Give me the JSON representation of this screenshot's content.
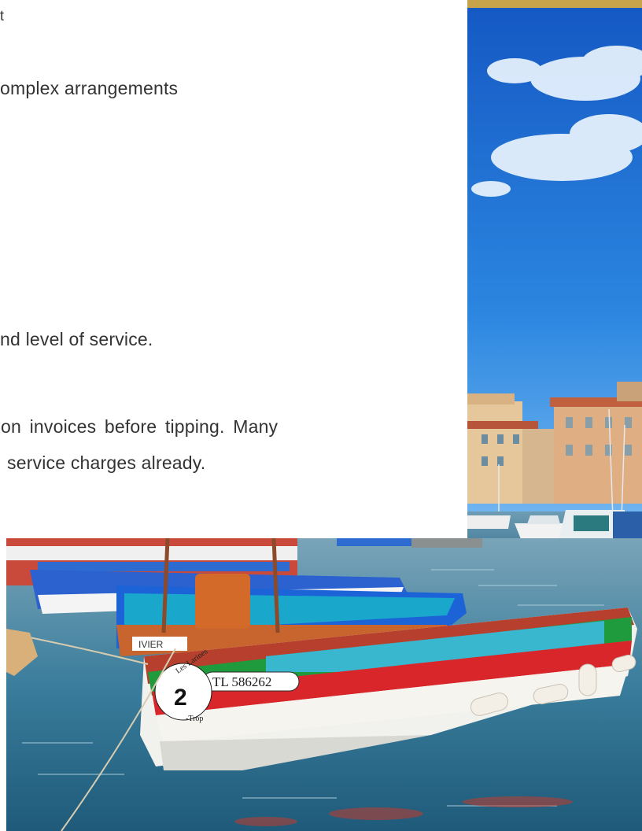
{
  "document": {
    "lines": [
      "omplex arrangements",
      "nd level of service.",
      "on invoices before tipping. Many",
      "service charges already."
    ],
    "fragment_top": "t"
  },
  "photos": {
    "right": {
      "subject": "harbor buildings under blue sky"
    },
    "bottom": {
      "subject": "colorful wooden fishing boats",
      "boat_registration": "TL 586262",
      "boat_number": "2",
      "boat_name_fragment": "IVIER",
      "stern_lettering_1": "Les Larines",
      "stern_lettering_2": "-Trop"
    }
  },
  "colors": {
    "sky": "#1c6fd0",
    "water": "#2a6f93",
    "boat_green": "#1f9a3c",
    "boat_red": "#d9262b",
    "boat_cyan": "#1aa7cc",
    "boat_blue": "#1d63d8"
  }
}
